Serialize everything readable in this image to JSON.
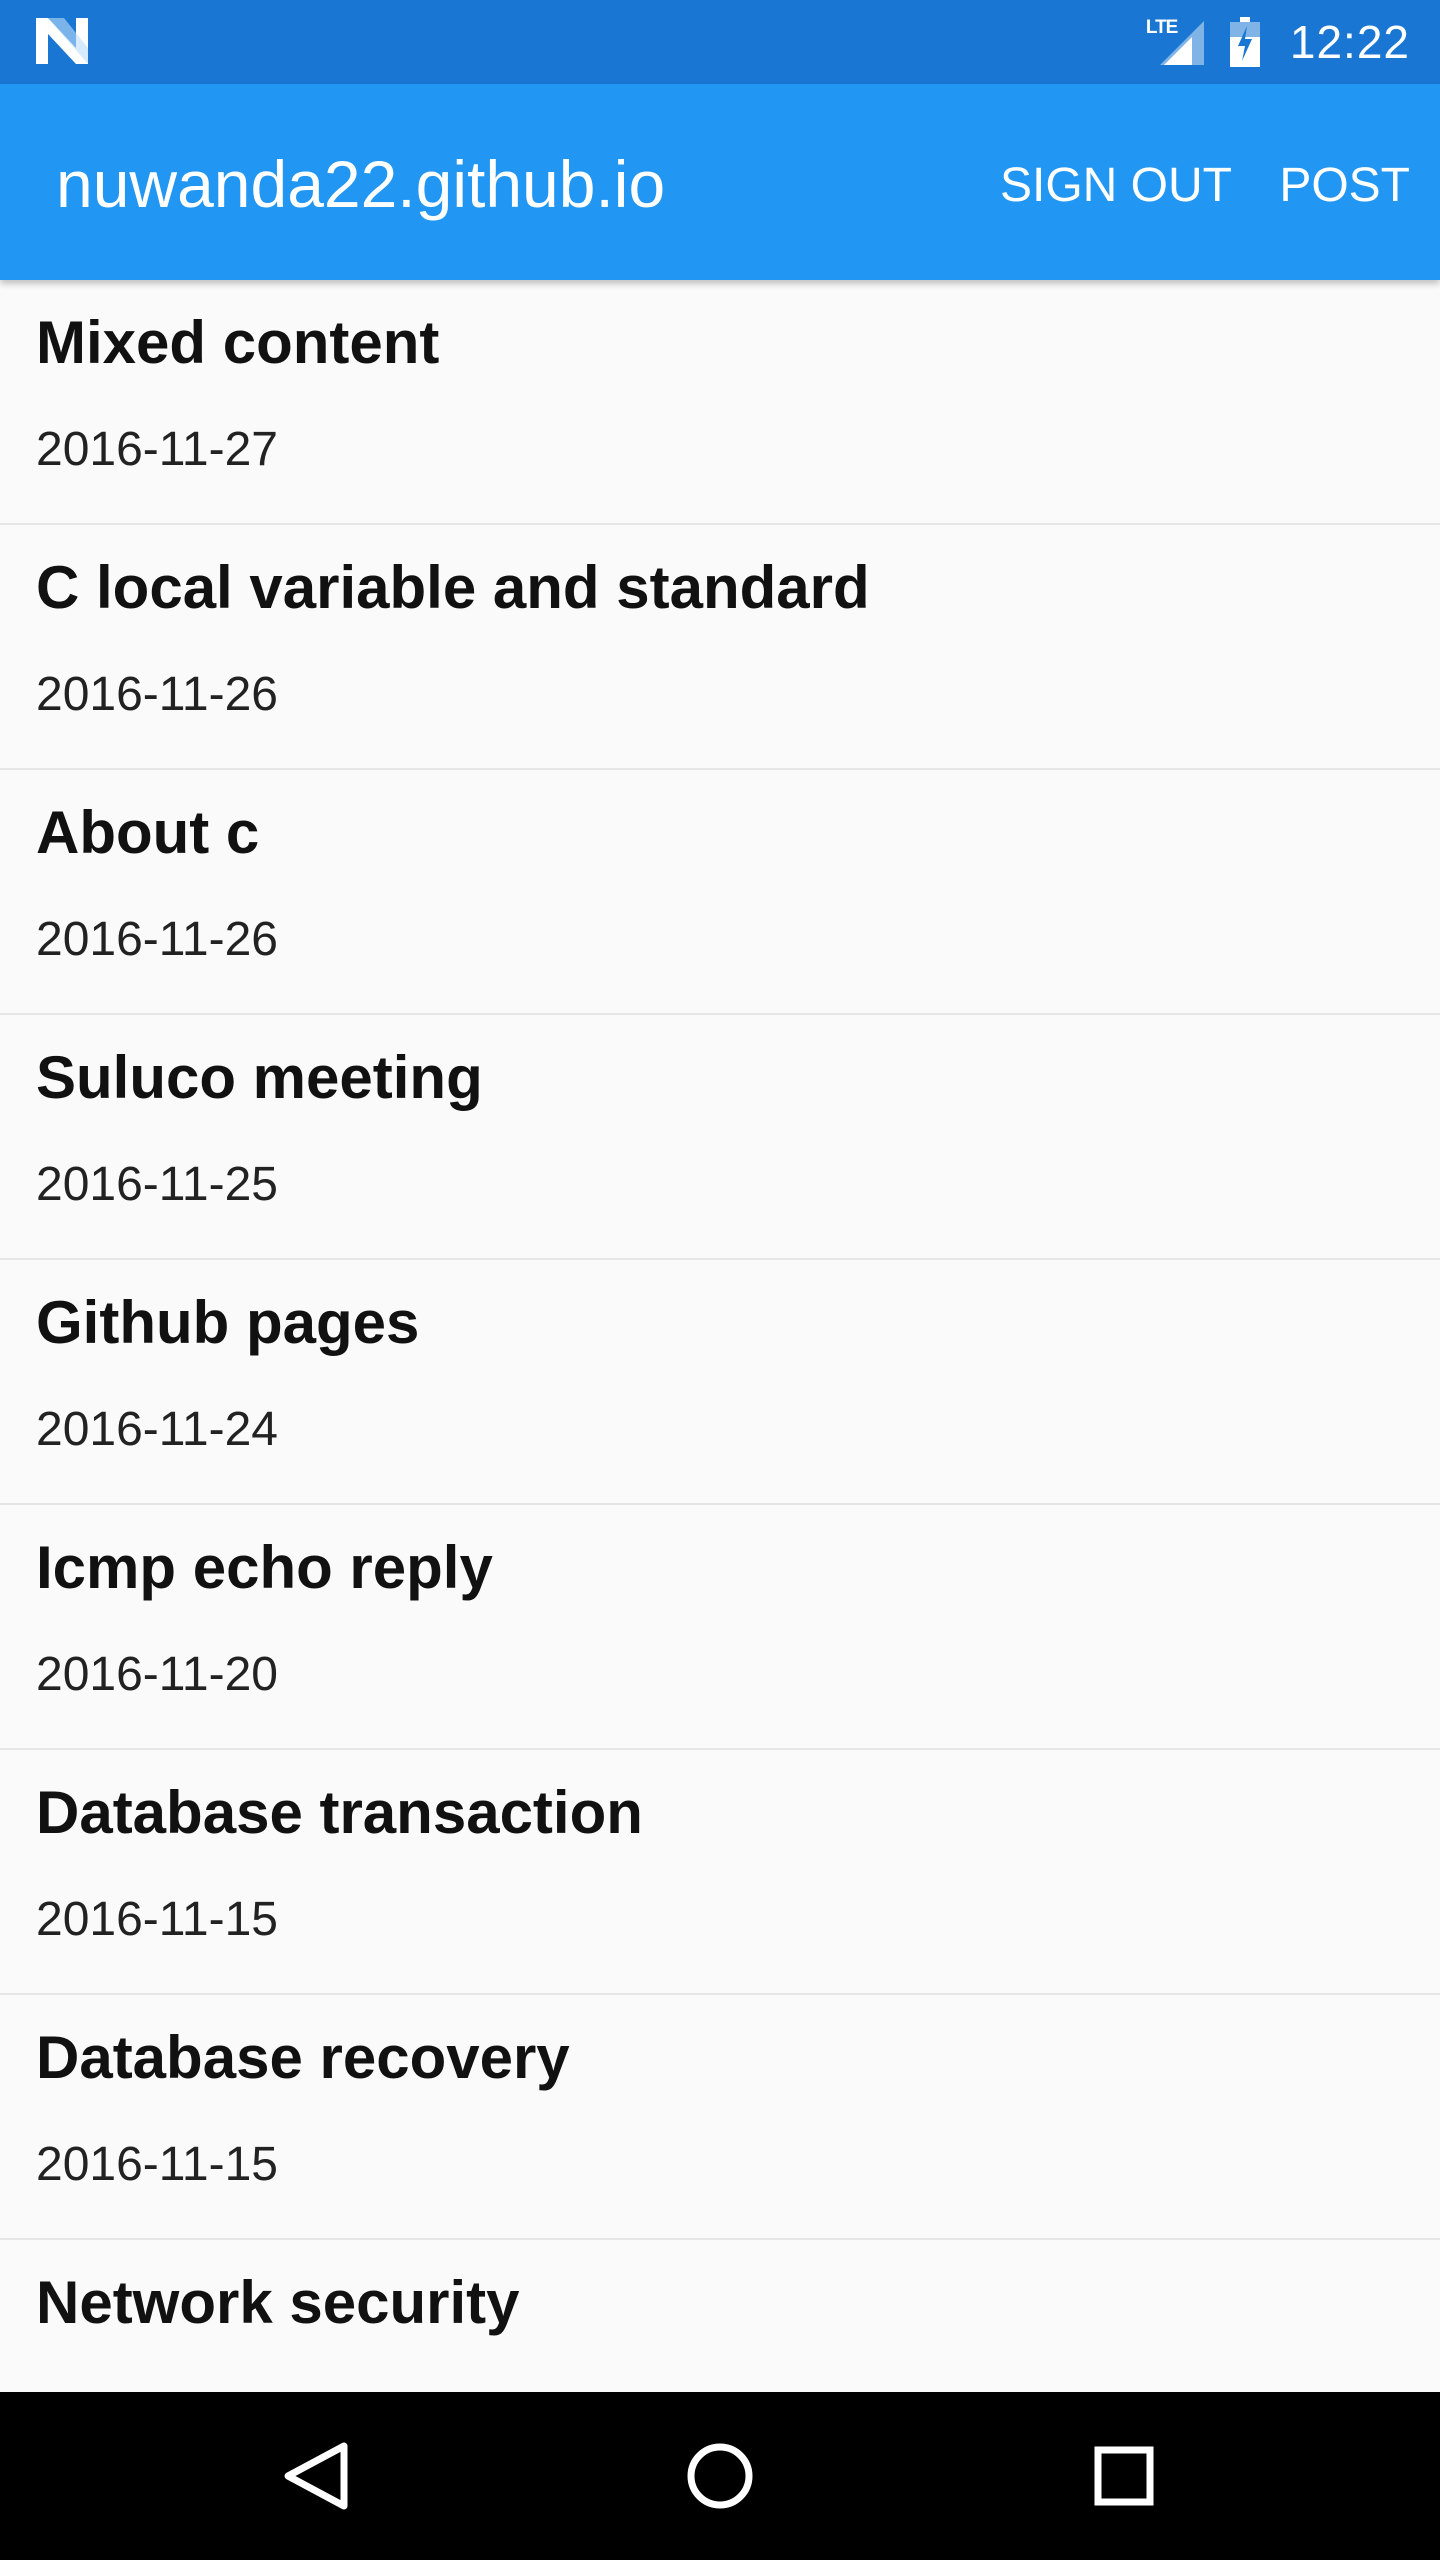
{
  "status_bar": {
    "time": "12:22",
    "network_label": "LTE",
    "left_icon": "n-logo-icon",
    "signal_icon": "signal-icon",
    "battery_icon": "battery-charging-icon",
    "background_color": "#1976d2"
  },
  "app_bar": {
    "title": "nuwanda22.github.io",
    "actions": {
      "sign_out": "SIGN OUT",
      "post": "POST"
    },
    "background_color": "#2196f3"
  },
  "posts": [
    {
      "title": "Mixed content",
      "date": "2016-11-27"
    },
    {
      "title": "C local variable and standard",
      "date": "2016-11-26"
    },
    {
      "title": "About c",
      "date": "2016-11-26"
    },
    {
      "title": "Suluco meeting",
      "date": "2016-11-25"
    },
    {
      "title": "Github pages",
      "date": "2016-11-24"
    },
    {
      "title": "Icmp echo reply",
      "date": "2016-11-20"
    },
    {
      "title": "Database transaction",
      "date": "2016-11-15"
    },
    {
      "title": "Database recovery",
      "date": "2016-11-15"
    },
    {
      "title": "Network security",
      "date": ""
    }
  ],
  "nav_bar": {
    "back_icon": "back-triangle-icon",
    "home_icon": "home-circle-icon",
    "recents_icon": "recents-square-icon"
  }
}
